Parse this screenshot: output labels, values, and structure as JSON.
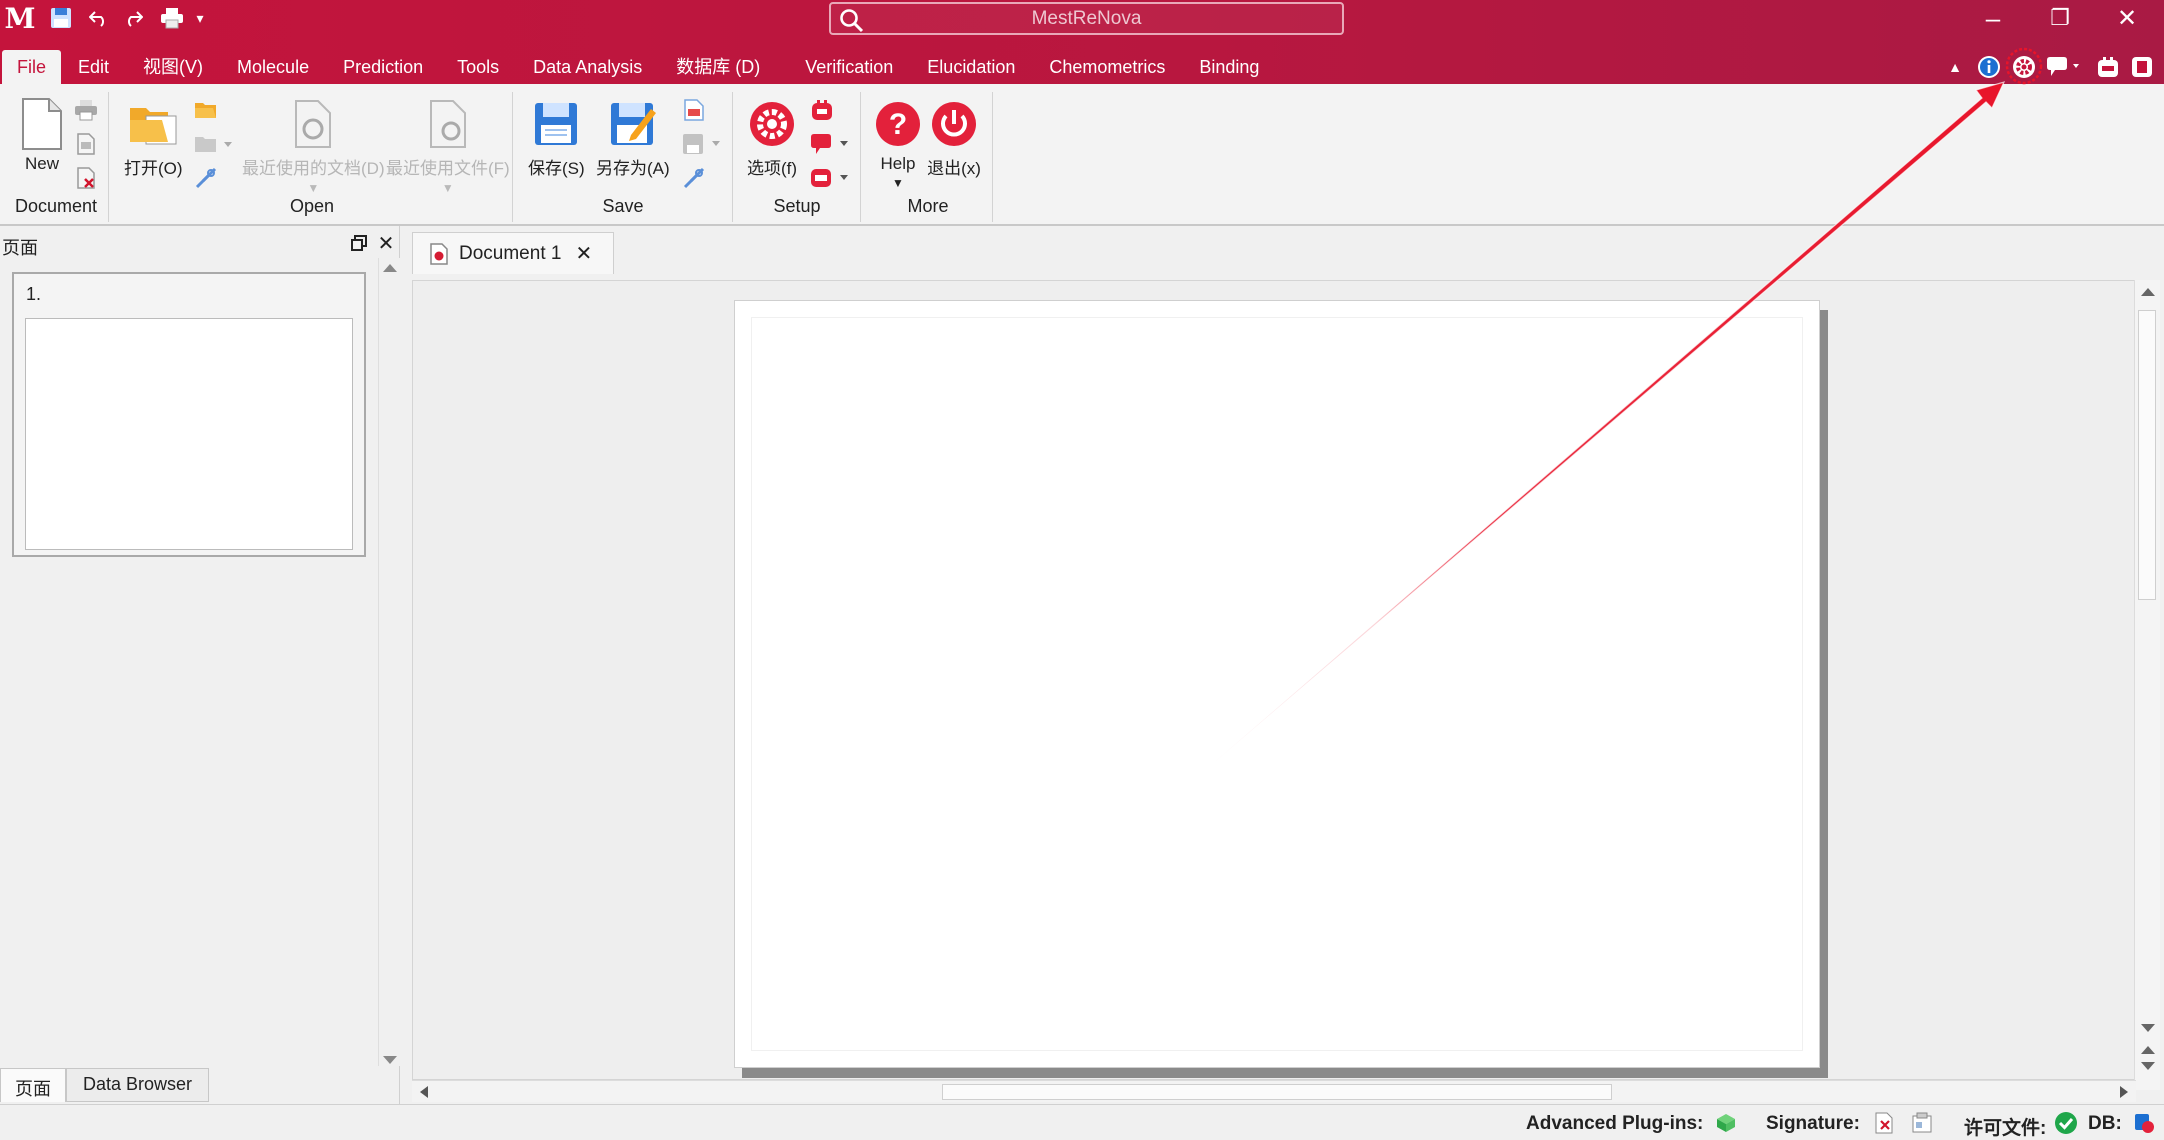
{
  "app": {
    "search_placeholder": "MestReNova"
  },
  "window_controls": {
    "minimize": "–",
    "restore": "❐",
    "close": "✕"
  },
  "menu": [
    {
      "label": "File",
      "active": true
    },
    {
      "label": "Edit"
    },
    {
      "label": "视图(V)"
    },
    {
      "label": "Molecule"
    },
    {
      "label": "Prediction"
    },
    {
      "label": "Tools"
    },
    {
      "label": "Data Analysis"
    },
    {
      "label": "数据库 (D)"
    },
    {
      "label": "Verification"
    },
    {
      "label": "Elucidation"
    },
    {
      "label": "Chemometrics"
    },
    {
      "label": "Binding"
    }
  ],
  "ribbon": {
    "document": {
      "group": "Document",
      "new": "New"
    },
    "open": {
      "group": "Open",
      "open": "打开(O)",
      "recent_docs": "最近使用的文档(D)",
      "recent_files": "最近使用文件(F)"
    },
    "save": {
      "group": "Save",
      "save": "保存(S)",
      "save_as": "另存为(A)"
    },
    "setup": {
      "group": "Setup",
      "options": "选项(f)"
    },
    "more": {
      "group": "More",
      "help": "Help",
      "exit": "退出(x)"
    }
  },
  "pages_panel": {
    "title": "页面",
    "thumbnail_number": "1."
  },
  "bottom_tabs": [
    {
      "label": "页面",
      "active": true
    },
    {
      "label": "Data Browser"
    }
  ],
  "document_tab": {
    "label": "Document 1"
  },
  "status": {
    "plugins": "Advanced Plug-ins:",
    "signature": "Signature:",
    "license": "许可文件:",
    "db": "DB:"
  },
  "colors": {
    "brand": "#c4143c",
    "accent_blue": "#1c6fd1",
    "ok_green": "#1fa64a",
    "annotation_red": "#e8142a"
  }
}
